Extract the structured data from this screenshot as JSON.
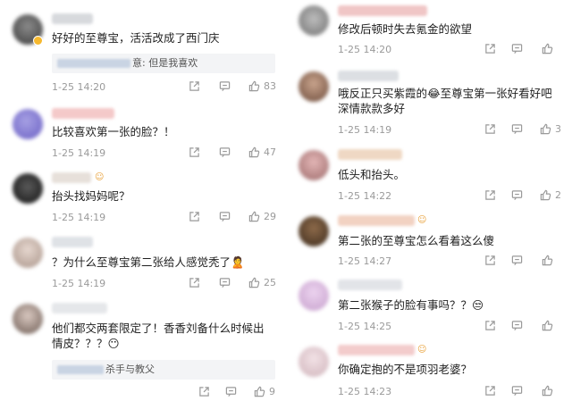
{
  "colors": {
    "text": "#1f1f1f",
    "meta": "#9a9a9a",
    "quote_bg": "#f3f4f6",
    "badge": "#f6b82e"
  },
  "icons": {
    "share": "share-icon",
    "comment": "comment-icon",
    "like": "like-icon"
  },
  "left": [
    {
      "text_lines": [
        "好好的至尊宝，活活改成了西门庆"
      ],
      "quote": "意: 但是我喜欢",
      "time": "1-25 14:20",
      "likes": "83"
    },
    {
      "text_lines": [
        "比较喜欢第一张的脸？！"
      ],
      "time": "1-25 14:19",
      "likes": "47"
    },
    {
      "text_lines": [
        "抬头找妈妈呢？"
      ],
      "time": "1-25 14:19",
      "likes": "29"
    },
    {
      "text_lines": [
        "？为什么至尊宝第二张给人感觉秃了🙎"
      ],
      "time": "1-25 14:19",
      "likes": "25"
    },
    {
      "text_lines": [
        "他们都交两套限定了！香香刘备什么时候出",
        "情皮？？？😶"
      ],
      "quote": "杀手与教父",
      "likes": "9"
    }
  ],
  "right": [
    {
      "text_lines": [
        "修改后顿时失去氪金的欲望"
      ],
      "time": "1-25 14:20",
      "likes": ""
    },
    {
      "text_lines": [
        "哦反正只买紫霞的😂至尊宝第一张好看好吧",
        "深情款款多好"
      ],
      "time": "1-25 14:19",
      "likes": "3"
    },
    {
      "text_lines": [
        "低头和抬头。"
      ],
      "time": "1-25 14:22",
      "likes": "2"
    },
    {
      "text_lines": [
        "第二张的至尊宝怎么看着这么傻"
      ],
      "time": "1-25 14:27",
      "likes": ""
    },
    {
      "text_lines": [
        "第二张猴子的脸有事吗？？😒"
      ],
      "time": "1-25 14:25",
      "likes": ""
    },
    {
      "text_lines": [
        "你确定抱的不是项羽老婆？"
      ],
      "time": "1-25 14:23",
      "likes": ""
    }
  ]
}
